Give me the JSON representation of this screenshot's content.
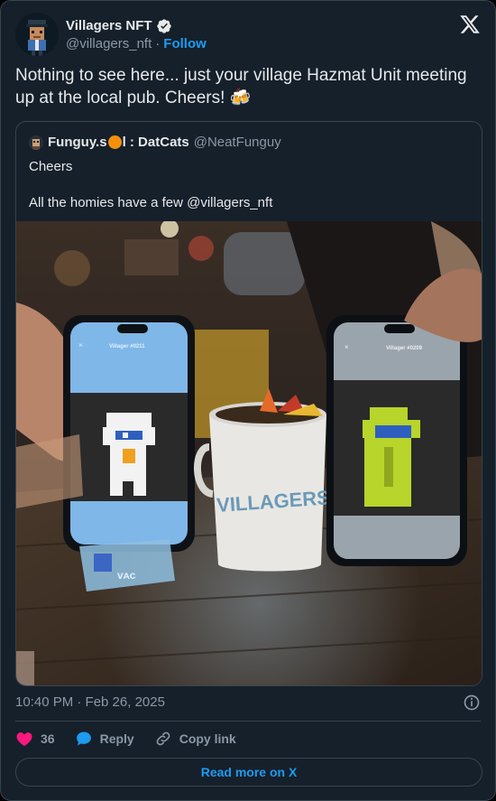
{
  "author": {
    "display_name": "Villagers NFT",
    "handle": "@villagers_nft",
    "separator": "·",
    "follow_label": "Follow",
    "verified_icon": "verified-badge-icon",
    "avatar_icon": "pixel-villager-avatar"
  },
  "tweet": {
    "text": "Nothing to see here... just your village Hazmat Unit meeting up at the local pub. Cheers! 🍻"
  },
  "quote": {
    "name_prefix": "Funguy.s",
    "name_suffix": "l : DatCats",
    "handle": "@NeatFunguy",
    "line1": "Cheers",
    "line2": "All the homies have a few @villagers_nft",
    "photo": {
      "left_phone_title": "Villager #0211",
      "right_phone_title": "Villager #0209",
      "mug_text": "VILLAGERS",
      "close_glyph": "×"
    }
  },
  "timestamp": "10:40 PM · Feb 26, 2025",
  "actions": {
    "like_count": "36",
    "reply_label": "Reply",
    "copy_label": "Copy link"
  },
  "read_more_label": "Read more on X",
  "colors": {
    "background": "#15202b",
    "border": "#38444d",
    "accent": "#1d9bf0",
    "like": "#f91880",
    "muted_text": "#8b98a5"
  }
}
